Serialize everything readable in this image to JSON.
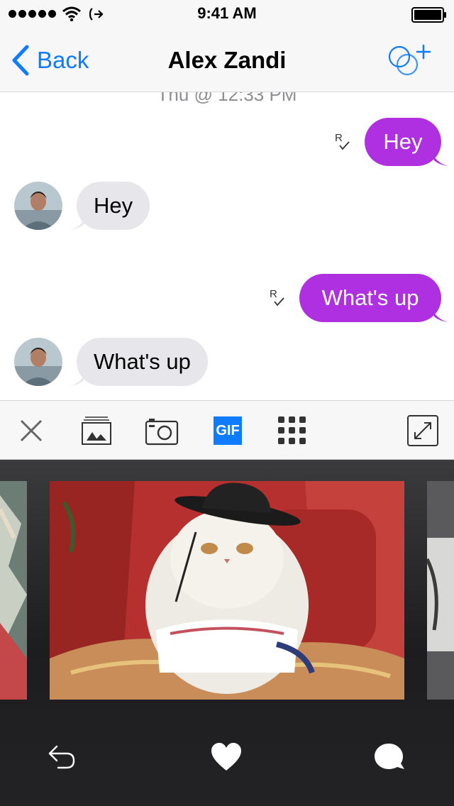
{
  "status_bar": {
    "time": "9:41 AM",
    "signal_icon": "signal-dots-icon",
    "wifi_icon": "wifi-icon",
    "call_icon": "call-forward-icon",
    "battery_icon": "battery-icon"
  },
  "nav": {
    "back_label": "Back",
    "title": "Alex Zandi",
    "add_icon": "add-people-icon",
    "accent": "#0f7bff"
  },
  "conversation": {
    "timestamp": "Thu @ 12:33 PM",
    "messages": [
      {
        "direction": "outgoing",
        "text": "Hey",
        "read_receipt": "R✓"
      },
      {
        "direction": "incoming",
        "text": "Hey",
        "avatar": "avatar-icon"
      },
      {
        "direction": "outgoing",
        "text": "What's up",
        "read_receipt": "R✓"
      },
      {
        "direction": "incoming",
        "text": "What's up",
        "avatar": "avatar-icon"
      }
    ],
    "outgoing_color": "#ae30e0",
    "incoming_color": "#e6e6eb"
  },
  "toolbar": {
    "close_icon": "close-icon",
    "gallery_icon": "photo-gallery-icon",
    "camera_icon": "camera-icon",
    "gif_label": "GIF",
    "apps_icon": "grid-icon",
    "expand_icon": "expand-icon"
  },
  "gif_panel": {
    "thumbnails": [
      "gif-thumb-left-partial",
      "gif-thumb-cat-in-hat",
      "gif-thumb-right-partial"
    ],
    "actions": {
      "reply_icon": "reply-icon",
      "like_icon": "heart-icon",
      "comment_icon": "chat-bubble-icon"
    }
  }
}
